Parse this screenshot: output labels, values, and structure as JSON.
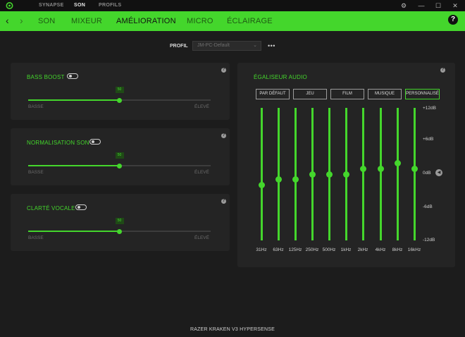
{
  "colors": {
    "accent": "#44d62c",
    "background": "#1c1c1c",
    "panel": "#242424",
    "titlebar": "#111111"
  },
  "titlebar": {
    "tabs": [
      {
        "label": "SYNAPSE",
        "active": false
      },
      {
        "label": "SON",
        "active": true
      },
      {
        "label": "PROFILS",
        "active": false
      }
    ],
    "icons": [
      "razer-logo-icon",
      "settings-icon",
      "minimize-icon",
      "maximize-icon",
      "close-icon"
    ]
  },
  "navbar": {
    "tabs": [
      {
        "label": "SON",
        "active": false
      },
      {
        "label": "MIXEUR",
        "active": false
      },
      {
        "label": "AMÉLIORATION",
        "active": true
      },
      {
        "label": "MICRO",
        "active": false
      },
      {
        "label": "ÉCLAIRAGE",
        "active": false
      }
    ],
    "help": "?"
  },
  "profile": {
    "label": "PROFIL",
    "value": "JM-PC-Default",
    "more": "•••"
  },
  "features": [
    {
      "label": "BASS BOOST",
      "enabled": false,
      "value": "50",
      "level": 0.5,
      "min_label": "BASSE",
      "max_label": "ÉLEVÉ"
    },
    {
      "label": "NORMALISATION SON",
      "enabled": false,
      "value": "50",
      "level": 0.5,
      "min_label": "BASSE",
      "max_label": "ÉLEVÉ"
    },
    {
      "label": "CLARTÉ VOCALE",
      "enabled": false,
      "value": "50",
      "level": 0.5,
      "min_label": "BASSE",
      "max_label": "ÉLEVÉ"
    }
  ],
  "equalizer": {
    "title": "ÉGALISEUR AUDIO",
    "presets": [
      {
        "label": "PAR DÉFAUT",
        "active": false
      },
      {
        "label": "JEU",
        "active": false
      },
      {
        "label": "FILM",
        "active": false
      },
      {
        "label": "MUSIQUE",
        "active": false
      },
      {
        "label": "PERSONNALISÉ",
        "active": true
      }
    ],
    "bands": [
      {
        "freq": "31Hz",
        "gain_db": -2
      },
      {
        "freq": "63Hz",
        "gain_db": -1
      },
      {
        "freq": "125Hz",
        "gain_db": -1
      },
      {
        "freq": "250Hz",
        "gain_db": 0
      },
      {
        "freq": "500Hz",
        "gain_db": 0
      },
      {
        "freq": "1kHz",
        "gain_db": 0
      },
      {
        "freq": "2kHz",
        "gain_db": 1
      },
      {
        "freq": "4kHz",
        "gain_db": 1
      },
      {
        "freq": "8kHz",
        "gain_db": 2
      },
      {
        "freq": "16kHz",
        "gain_db": 1
      }
    ],
    "db_labels": [
      "+12dB",
      "+6dB",
      "0dB",
      "-6dB",
      "-12dB"
    ],
    "range_db": [
      -12,
      12
    ]
  },
  "footer": "RAZER KRAKEN V3 HYPERSENSE"
}
